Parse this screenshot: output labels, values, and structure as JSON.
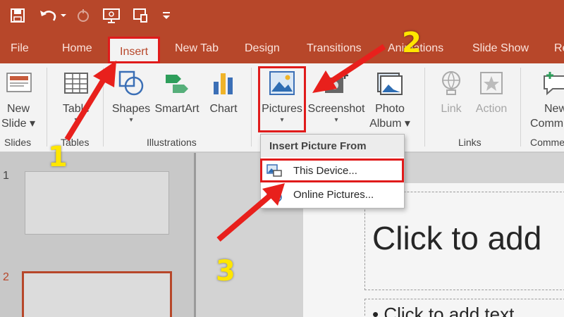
{
  "tabs": [
    "File",
    "Home",
    "Insert",
    "New Tab",
    "Design",
    "Transitions",
    "Animations",
    "Slide Show",
    "Re"
  ],
  "active_tab": "Insert",
  "ribbon": {
    "buttons": [
      {
        "label1": "New",
        "label2": "Slide ▾",
        "icon": "new-slide-icon"
      },
      {
        "label1": "Table",
        "label2": "",
        "icon": "table-icon"
      },
      {
        "label1": "Shapes",
        "label2": "",
        "icon": "shapes-icon"
      },
      {
        "label1": "SmartArt",
        "label2": "",
        "icon": "smartart-icon"
      },
      {
        "label1": "Chart",
        "label2": "",
        "icon": "chart-icon"
      },
      {
        "label1": "Pictures",
        "label2": "",
        "icon": "pictures-icon"
      },
      {
        "label1": "Screenshot",
        "label2": "",
        "icon": "screenshot-icon"
      },
      {
        "label1": "Photo",
        "label2": "Album ▾",
        "icon": "photo-album-icon"
      },
      {
        "label1": "Link",
        "label2": "",
        "icon": "link-icon"
      },
      {
        "label1": "Action",
        "label2": "",
        "icon": "action-icon"
      },
      {
        "label1": "New",
        "label2": "Comm",
        "icon": "new-comment-icon"
      }
    ],
    "groups": [
      "Slides",
      "Tables",
      "Illustrations",
      "Links",
      "Comme"
    ]
  },
  "dropdown": {
    "header": "Insert Picture From",
    "items": [
      "This Device...",
      "Online Pictures..."
    ]
  },
  "slide": {
    "title_placeholder": "Click to add",
    "body_placeholder": "• Click to add text"
  },
  "thumbnails": [
    "1",
    "2"
  ],
  "annotations": [
    "1",
    "2",
    "3"
  ],
  "colors": {
    "accent": "#b7472a",
    "highlight": "#e01b1b",
    "marker": "#ffe600"
  }
}
